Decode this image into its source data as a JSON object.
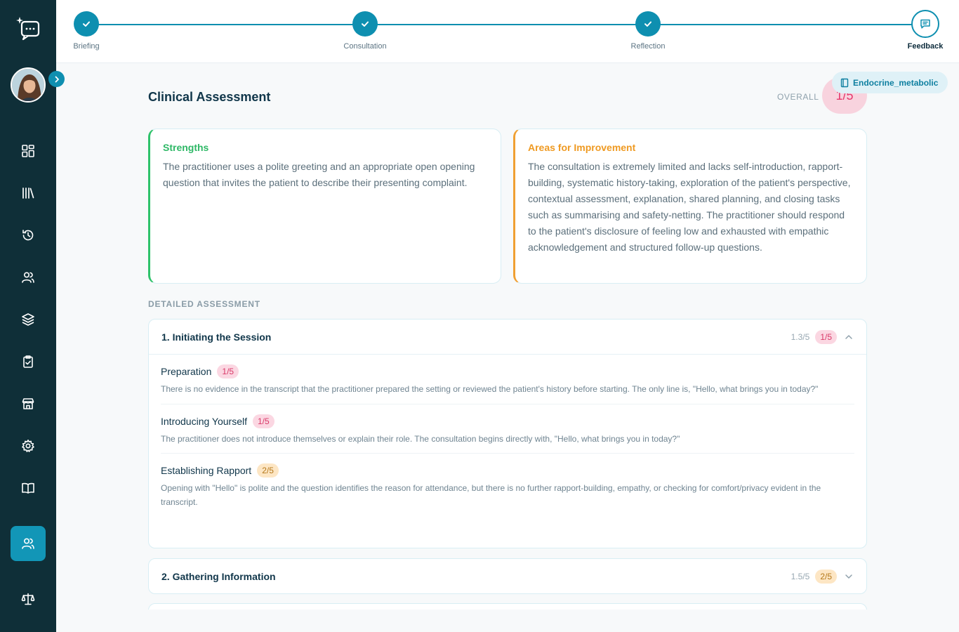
{
  "stepper": {
    "steps": [
      {
        "label": "Briefing",
        "status": "complete"
      },
      {
        "label": "Consultation",
        "status": "complete"
      },
      {
        "label": "Reflection",
        "status": "complete"
      },
      {
        "label": "Feedback",
        "status": "current"
      }
    ]
  },
  "sidebar": {
    "items": [
      {
        "name": "dashboard-icon"
      },
      {
        "name": "library-icon"
      },
      {
        "name": "history-icon"
      },
      {
        "name": "users-icon"
      },
      {
        "name": "layers-icon"
      },
      {
        "name": "clipboard-check-icon"
      },
      {
        "name": "store-icon"
      },
      {
        "name": "gear-icon"
      },
      {
        "name": "book-icon"
      },
      {
        "name": "group-icon",
        "active": true
      },
      {
        "name": "scale-icon"
      }
    ]
  },
  "topic_chip": "Endocrine_metabolic",
  "assessment": {
    "title": "Clinical Assessment",
    "overall_label": "OVERALL",
    "overall_score": "1/5",
    "strengths": {
      "heading": "Strengths",
      "text": "The practitioner uses a polite greeting and an appropriate open opening question that invites the patient to describe their presenting complaint."
    },
    "improvement": {
      "heading": "Areas for Improvement",
      "text": "The consultation is extremely limited and lacks self-introduction, rapport-building, systematic history-taking, exploration of the patient's perspective, contextual assessment, explanation, shared planning, and closing tasks such as summarising and safety-netting. The practitioner should respond to the patient's disclosure of feeling low and exhausted with empathic acknowledgement and structured follow-up questions."
    },
    "detailed_label": "DETAILED ASSESSMENT",
    "sections": [
      {
        "title": "1. Initiating the Session",
        "average": "1.3/5",
        "score": "1/5",
        "items": [
          {
            "name": "Preparation",
            "score": "1/5",
            "text": "There is no evidence in the transcript that the practitioner prepared the setting or reviewed the patient's history before starting. The only line is, \"Hello, what brings you in today?\""
          },
          {
            "name": "Introducing Yourself",
            "score": "1/5",
            "text": "The practitioner does not introduce themselves or explain their role. The consultation begins directly with, \"Hello, what brings you in today?\""
          },
          {
            "name": "Establishing Rapport",
            "score": "2/5",
            "text": "Opening with \"Hello\" is polite and the question identifies the reason for attendance, but there is no further rapport-building, empathy, or checking for comfort/privacy evident in the transcript."
          }
        ]
      },
      {
        "title": "2. Gathering Information",
        "average": "1.5/5",
        "score": "2/5"
      }
    ]
  },
  "colors": {
    "sidebar": "#0f2f38",
    "accent": "#0e8fb0",
    "strength": "#2ec26a",
    "improvement": "#f0a033",
    "low_score": "#e53a6d"
  }
}
